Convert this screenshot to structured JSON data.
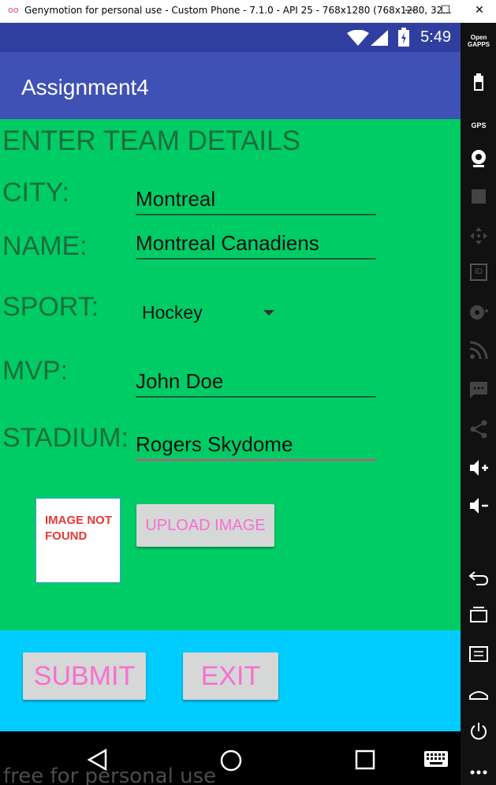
{
  "window": {
    "title": "Genymotion for personal use - Custom Phone - 7.1.0 - API 25 - 768x1280 (768x1280, 32...",
    "logo_text": "oo",
    "min_glyph": "—",
    "max_glyph": "☐",
    "close_glyph": "✕"
  },
  "statusbar": {
    "time": "5:49"
  },
  "appbar": {
    "title": "Assignment4"
  },
  "form": {
    "header": "ENTER TEAM DETAILS",
    "city_label": "CITY:",
    "city_value": "Montreal",
    "name_label": "NAME:",
    "name_value": "Montreal Canadiens",
    "sport_label": "SPORT:",
    "sport_value": "Hockey",
    "mvp_label": "MVP:",
    "mvp_value": "John Doe",
    "stadium_label": "STADIUM:",
    "stadium_value": "Rogers Skydome",
    "image_placeholder": "IMAGE NOT FOUND",
    "upload_label": "UPLOAD IMAGE"
  },
  "footer": {
    "submit_label": "SUBMIT",
    "exit_label": "EXIT"
  },
  "watermark": "free for personal use",
  "toolbar": {
    "open_gapps": "Open GAPPS",
    "gps": "GPS",
    "id": "ID"
  },
  "colors": {
    "statusbar": "#303f9f",
    "appbar": "#3f51b5",
    "content_bg": "#00cc66",
    "footer_bg": "#00ccff",
    "button_text": "#f76fd0",
    "label_text": "#1b6d3d",
    "active_underline": "#e63f82"
  }
}
